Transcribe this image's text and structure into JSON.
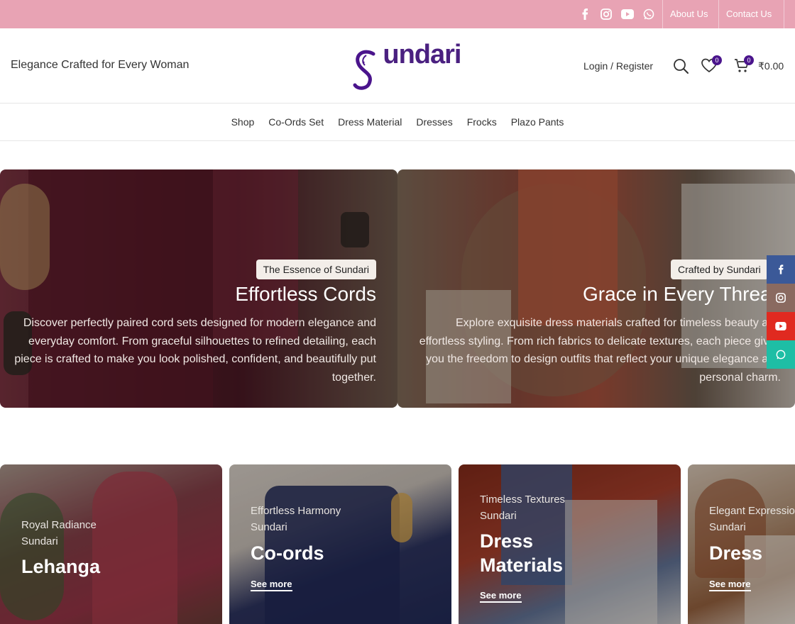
{
  "topbar": {
    "socials": [
      {
        "name": "facebook-icon"
      },
      {
        "name": "instagram-icon"
      },
      {
        "name": "youtube-icon"
      },
      {
        "name": "whatsapp-icon"
      }
    ],
    "about_label": "About Us",
    "contact_label": "Contact Us",
    "bg_color": "#e8a3b4"
  },
  "header": {
    "tagline": "Elegance Crafted for Every Woman",
    "logo_text": "Sundari",
    "login_label": "Login / Register",
    "wishlist_count": "0",
    "cart_count": "0",
    "cart_total": "₹0.00",
    "brand_color": "#4a148c"
  },
  "nav": {
    "items": [
      "Shop",
      "Co-Ords Set",
      "Dress Material",
      "Dresses",
      "Frocks",
      "Plazo Pants"
    ]
  },
  "banners": [
    {
      "tag": "The Essence of Sundari",
      "title": "Effortless Cords",
      "description": "Discover perfectly paired cord sets designed for modern elegance and everyday comfort. From graceful silhouettes to refined detailing, each piece is crafted to make you look polished, confident, and beautifully put together."
    },
    {
      "tag": "Crafted by Sundari",
      "title": "Grace in Every Thread",
      "description": "Explore exquisite dress materials crafted for timeless beauty and effortless styling. From rich fabrics to delicate textures, each piece gives you the freedom to design outfits that reflect your unique elegance and personal charm."
    }
  ],
  "floating_social": [
    {
      "name": "facebook-icon",
      "color": "#3b5998"
    },
    {
      "name": "instagram-icon",
      "color": "#8a6a60"
    },
    {
      "name": "youtube-icon",
      "color": "#e02a20"
    },
    {
      "name": "whatsapp-icon",
      "color": "#1ebea5"
    }
  ],
  "categories": [
    {
      "subtitle": "Royal Radiance",
      "brand": "Sundari",
      "title": "Lehanga",
      "link": ""
    },
    {
      "subtitle": "Effortless Harmony",
      "brand": "Sundari",
      "title": "Co-ords",
      "link": "See more"
    },
    {
      "subtitle": "Timeless Textures",
      "brand": "Sundari",
      "title_line1": "Dress",
      "title_line2": "Materials",
      "link": "See more"
    },
    {
      "subtitle": "Elegant Expression",
      "brand": "Sundari",
      "title": "Dress",
      "link": "See more"
    }
  ]
}
